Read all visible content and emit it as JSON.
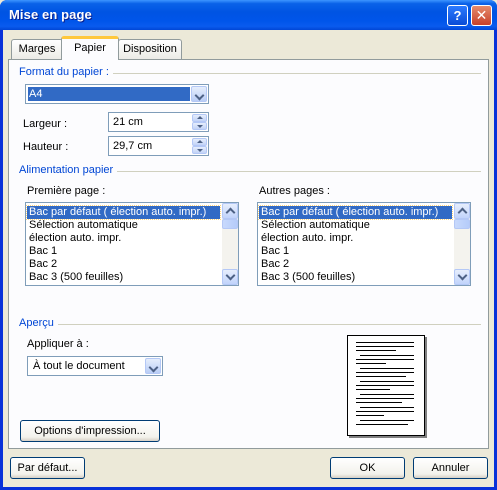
{
  "window": {
    "title": "Mise en page",
    "help_glyph": "?",
    "close_glyph": "✕"
  },
  "tabs": [
    {
      "label": "Marges",
      "active": false
    },
    {
      "label": "Papier",
      "active": true
    },
    {
      "label": "Disposition",
      "active": false
    }
  ],
  "paper_format": {
    "group_title": "Format du papier :",
    "selected": "A4",
    "width_label": "Largeur :",
    "width_value": "21 cm",
    "height_label": "Hauteur :",
    "height_value": "29,7 cm"
  },
  "paper_source": {
    "group_title": "Alimentation papier",
    "first_page_label": "Première page :",
    "other_pages_label": "Autres pages :",
    "first_page_items": [
      "Bac par défaut ( élection auto. impr.)",
      "Sélection automatique",
      "élection auto. impr.",
      "Bac 1",
      "Bac 2",
      "Bac 3 (500 feuilles)"
    ],
    "other_pages_items": [
      "Bac par défaut ( élection auto. impr.)",
      "Sélection automatique",
      "élection auto. impr.",
      "Bac 1",
      "Bac 2",
      "Bac 3 (500 feuilles)"
    ]
  },
  "preview": {
    "group_title": "Aperçu",
    "apply_label": "Appliquer à :",
    "apply_value": "À tout le document"
  },
  "buttons": {
    "print_options": "Options d'impression...",
    "default": "Par défaut...",
    "ok": "OK",
    "cancel": "Annuler"
  },
  "colors": {
    "title_bar": "#0054E3",
    "group_title": "#0046D5",
    "selection": "#316AC5",
    "dialog_bg": "#ECE9D8"
  }
}
